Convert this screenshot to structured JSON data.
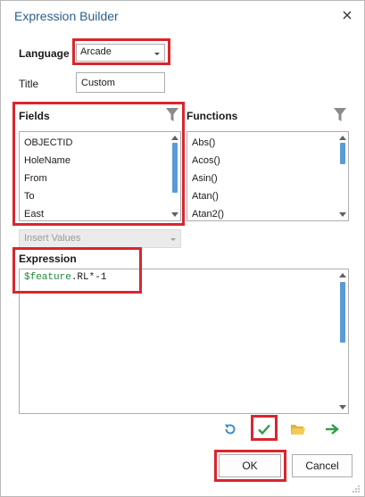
{
  "window": {
    "title": "Expression Builder",
    "close_icon": "close-icon"
  },
  "language": {
    "label": "Language",
    "value": "Arcade"
  },
  "title_field": {
    "label": "Title",
    "value": "Custom"
  },
  "fields": {
    "label": "Fields",
    "items": [
      "OBJECTID",
      "HoleName",
      "From",
      "To",
      "East"
    ],
    "filter_icon": "funnel-icon"
  },
  "functions": {
    "label": "Functions",
    "items": [
      "Abs()",
      "Acos()",
      "Asin()",
      "Atan()",
      "Atan2()"
    ],
    "filter_icon": "funnel-icon"
  },
  "insert_values": {
    "label": "Insert Values",
    "enabled": false
  },
  "expression": {
    "label": "Expression",
    "keyword": "$feature",
    "rest": ".RL*-1"
  },
  "toolbar": {
    "icons": [
      "undo-icon",
      "verify-check-icon",
      "open-folder-icon",
      "export-arrow-icon"
    ]
  },
  "buttons": {
    "ok": "OK",
    "cancel": "Cancel"
  },
  "colors": {
    "highlight": "#d9262e",
    "title": "#2b5f8a",
    "keyword": "#1d8a3b",
    "scroll_thumb": "#5b9bd5"
  }
}
